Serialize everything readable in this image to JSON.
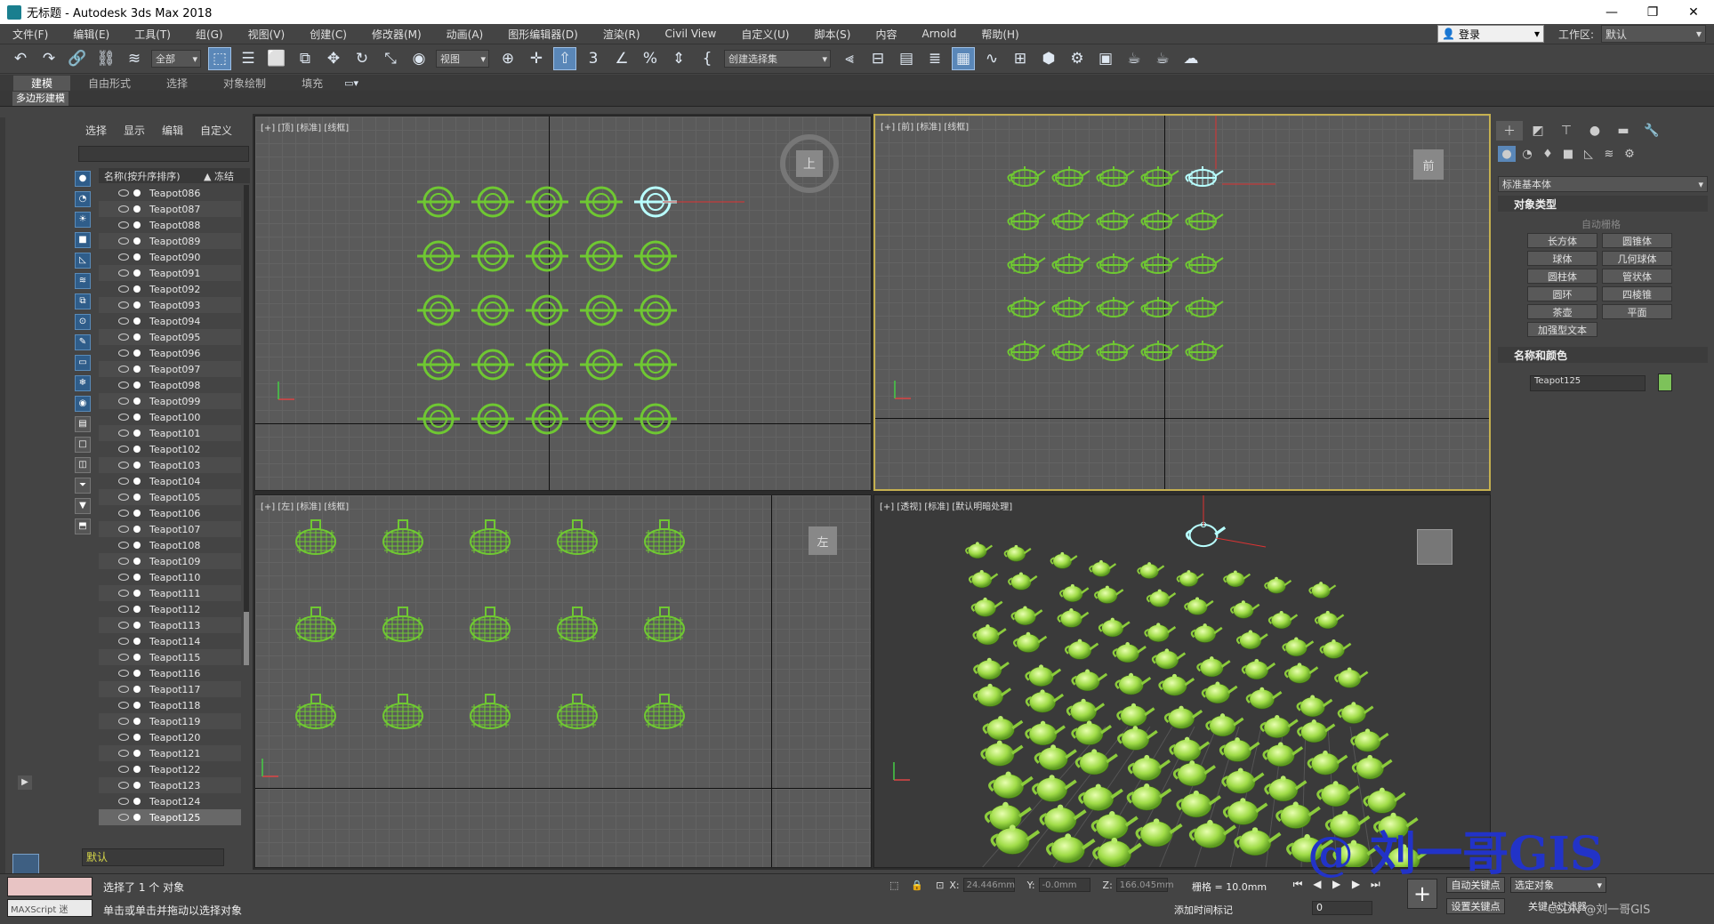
{
  "window": {
    "title": "无标题 - Autodesk 3ds Max 2018",
    "minimize": "—",
    "maximize": "❐",
    "close": "✕"
  },
  "menu": [
    "文件(F)",
    "编辑(E)",
    "工具(T)",
    "组(G)",
    "视图(V)",
    "创建(C)",
    "修改器(M)",
    "动画(A)",
    "图形编辑器(D)",
    "渲染(R)",
    "Civil View",
    "自定义(U)",
    "脚本(S)",
    "内容",
    "Arnold",
    "帮助(H)"
  ],
  "account": {
    "login": "登录",
    "workspace_label": "工作区:",
    "workspace": "默认"
  },
  "toolbar": {
    "filter": "全部",
    "ref_coord": "视图",
    "named_set": "创建选择集"
  },
  "ribbon": {
    "tabs": [
      "建模",
      "自由形式",
      "选择",
      "对象绘制",
      "填充"
    ],
    "selected": "建模",
    "sub_button": "多边形建模"
  },
  "scene_explorer": {
    "tabs": [
      "选择",
      "显示",
      "编辑",
      "自定义"
    ],
    "col_name": "名称(按升序排序)",
    "col_freeze": "▲ 冻结",
    "items": [
      "Teapot086",
      "Teapot087",
      "Teapot088",
      "Teapot089",
      "Teapot090",
      "Teapot091",
      "Teapot092",
      "Teapot093",
      "Teapot094",
      "Teapot095",
      "Teapot096",
      "Teapot097",
      "Teapot098",
      "Teapot099",
      "Teapot100",
      "Teapot101",
      "Teapot102",
      "Teapot103",
      "Teapot104",
      "Teapot105",
      "Teapot106",
      "Teapot107",
      "Teapot108",
      "Teapot109",
      "Teapot110",
      "Teapot111",
      "Teapot112",
      "Teapot113",
      "Teapot114",
      "Teapot115",
      "Teapot116",
      "Teapot117",
      "Teapot118",
      "Teapot119",
      "Teapot120",
      "Teapot121",
      "Teapot122",
      "Teapot123",
      "Teapot124",
      "Teapot125"
    ],
    "selected": "Teapot125",
    "layer": "默认"
  },
  "viewports": {
    "top": {
      "label": "[+] [顶] [标准] [线框]",
      "cube": "上"
    },
    "front": {
      "label": "[+] [前] [标准] [线框]",
      "cube": "前"
    },
    "left": {
      "label": "[+] [左] [标准] [线框]",
      "cube": "左"
    },
    "persp": {
      "label": "[+] [透视] [标准] [默认明暗处理]"
    }
  },
  "command_panel": {
    "category": "标准基本体",
    "section_object_type": "对象类型",
    "autogrid": "自动栅格",
    "primitives": [
      "长方体",
      "圆锥体",
      "球体",
      "几何球体",
      "圆柱体",
      "管状体",
      "圆环",
      "四棱锥",
      "茶壶",
      "平面",
      "加强型文本"
    ],
    "section_name_color": "名称和颜色",
    "object_name": "Teapot125",
    "object_color": "#7dc25a"
  },
  "status": {
    "maxscript": "MAXScript 迷",
    "selected": "选择了 1 个 对象",
    "prompt": "单击或单击并拖动以选择对象",
    "x_label": "X:",
    "x": "24.446mm",
    "y_label": "Y:",
    "y": "-0.0mm",
    "z_label": "Z:",
    "z": "166.045mm",
    "grid": "栅格 = 10.0mm",
    "add_time_tag": "添加时间标记",
    "frame": "0",
    "auto_key": "自动关键点",
    "set_key": "设置关键点",
    "selection_set": "选定对象",
    "key_filters": "关键点过滤器..."
  },
  "watermark": {
    "text": "@ 刘一哥GIS",
    "small": "CSDN @刘一哥GIS"
  },
  "colors": {
    "teapot": "#6fc832",
    "teapot_selected": "#b8ffff",
    "active_border": "#c5b050",
    "accent": "#5a87b8"
  }
}
